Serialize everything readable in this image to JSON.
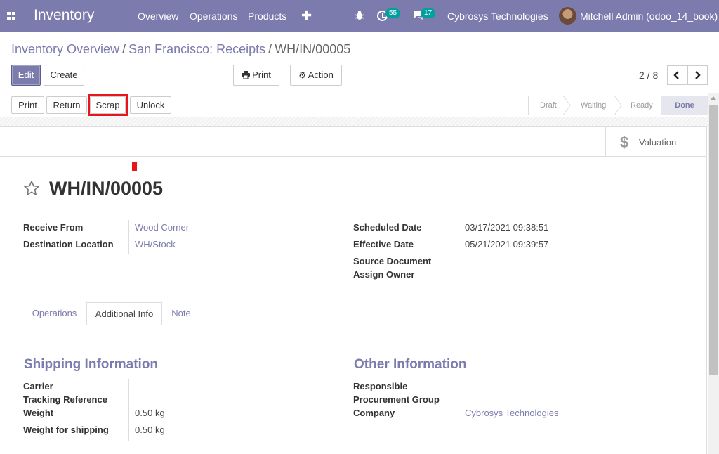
{
  "navbar": {
    "app_name": "Inventory",
    "menu": [
      "Overview",
      "Operations",
      "Products"
    ],
    "plus_icon": "plus-icon",
    "activity_count": "55",
    "message_count": "17",
    "company": "Cybrosys Technologies",
    "user": "Mitchell Admin (odoo_14_book)",
    "brand_color": "#7c7bad"
  },
  "breadcrumb": {
    "items": [
      "Inventory Overview",
      "San Francisco: Receipts"
    ],
    "current": "WH/IN/00005"
  },
  "control": {
    "edit": "Edit",
    "create": "Create",
    "print": "Print",
    "action": "Action",
    "pager": "2 / 8"
  },
  "statusbar": {
    "buttons": [
      "Print",
      "Return",
      "Scrap",
      "Unlock"
    ],
    "stages": [
      "Draft",
      "Waiting",
      "Ready",
      "Done"
    ],
    "current_stage": "Done",
    "highlight_color": "#e8151b"
  },
  "sheet": {
    "valuation": "Valuation",
    "title": "WH/IN/00005",
    "left_fields": [
      {
        "label": "Receive From",
        "value": "Wood Corner"
      },
      {
        "label": "Destination Location",
        "value": "WH/Stock"
      }
    ],
    "right_fields": [
      {
        "label": "Scheduled Date",
        "value": "03/17/2021 09:38:51"
      },
      {
        "label": "Effective Date",
        "value": "05/21/2021 09:39:57"
      },
      {
        "label": "Source Document",
        "value": ""
      },
      {
        "label": "Assign Owner",
        "value": ""
      }
    ],
    "tabs": [
      "Operations",
      "Additional Info",
      "Note"
    ],
    "active_tab": "Additional Info",
    "shipping": {
      "title": "Shipping Information",
      "fields": [
        {
          "label": "Carrier",
          "value": ""
        },
        {
          "label": "Tracking Reference",
          "value": ""
        },
        {
          "label": "Weight",
          "value": "0.50",
          "unit": "kg"
        },
        {
          "label": "Weight for shipping",
          "value": "0.50",
          "unit": "kg"
        }
      ]
    },
    "other": {
      "title": "Other Information",
      "fields": [
        {
          "label": "Responsible",
          "value": ""
        },
        {
          "label": "Procurement Group",
          "value": ""
        },
        {
          "label": "Company",
          "value": "Cybrosys Technologies"
        }
      ]
    }
  }
}
